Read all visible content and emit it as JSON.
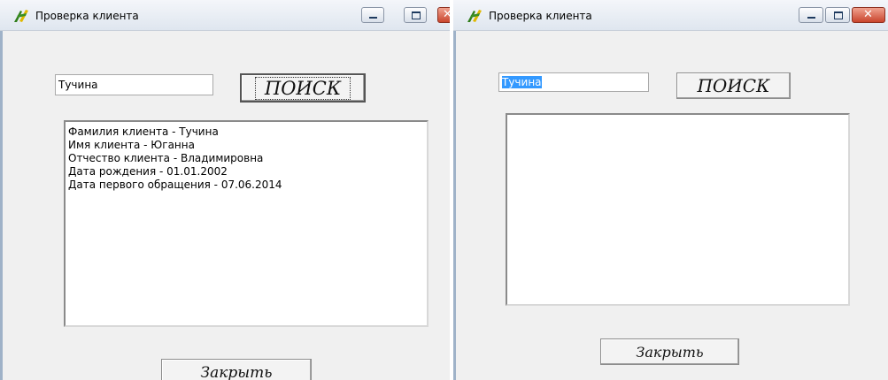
{
  "left_window": {
    "title": "Проверка клиента",
    "search_value": "Тучина",
    "search_button": "ПОИСК",
    "result_lines": [
      "Фамилия клиента - Тучина",
      "Имя клиента - Юганна",
      "Отчество клиента - Владимировна",
      "Дата рождения - 01.01.2002",
      "Дата первого обращения - 07.06.2014"
    ],
    "close_button": "Закрыть"
  },
  "right_window": {
    "title": "Проверка клиента",
    "search_value": "Тучина",
    "search_button": "ПОИСК",
    "close_button": "Закрыть"
  },
  "icons": {
    "app": "app-icon",
    "minimize": "minimize-icon",
    "maximize": "maximize-icon",
    "close": "close-icon"
  },
  "colors": {
    "selection": "#3399ff",
    "close_button": "#c9452d",
    "window_bg": "#f0f0f0"
  }
}
